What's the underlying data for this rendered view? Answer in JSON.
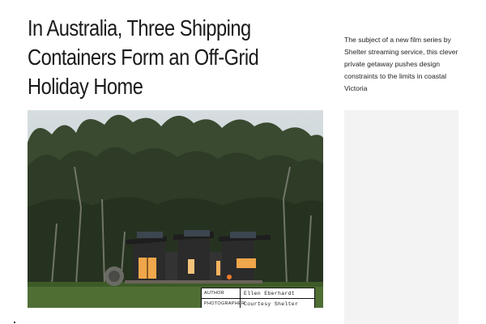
{
  "article": {
    "headline": "In Australia, Three Shipping Containers Form an Off-Grid Holiday Home",
    "dek": "The subject of a new film series by Shelter streaming service, this clever private getaway pushes design constraints to the limits in coastal Victoria"
  },
  "credits": {
    "author_label": "AUTHOR",
    "author_name": "Ellen Eberhardt",
    "photographer_label": "PHOTOGRAPHER",
    "photographer_name": "Courtesy Shelter"
  },
  "colors": {
    "sky": "#c9d2d6",
    "foliage_dark": "#2d3a26",
    "foliage_mid": "#4a5a3a",
    "grass": "#4f6e34",
    "cabin": "#2b2b2b",
    "window_glow": "#f0a64a"
  }
}
